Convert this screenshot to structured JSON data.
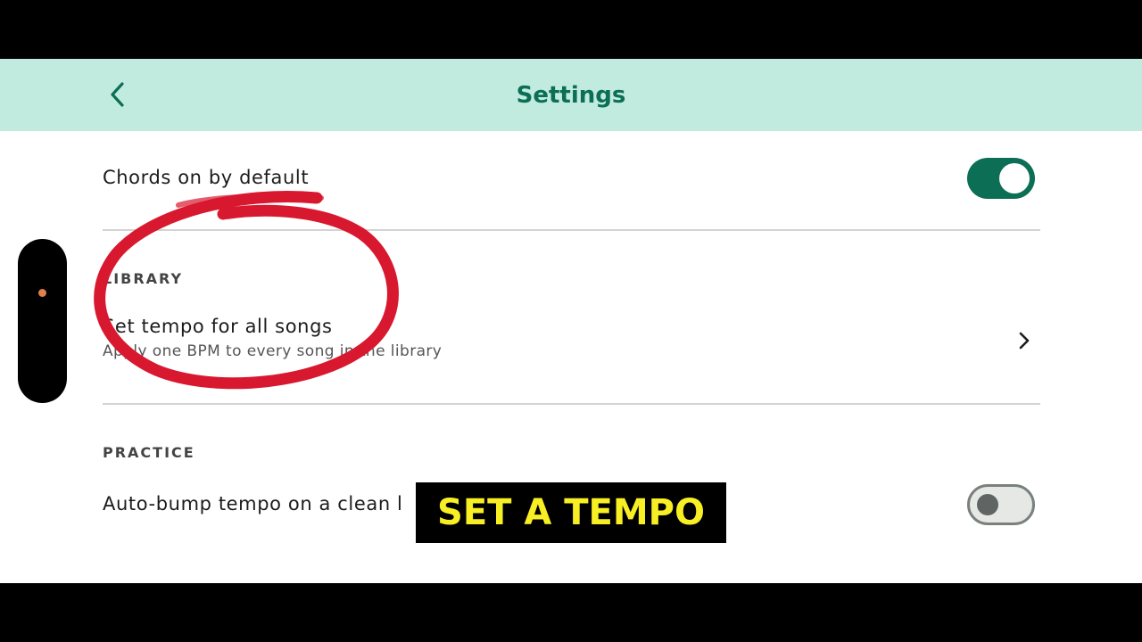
{
  "header": {
    "title": "Settings",
    "back_icon": "chevron-left-icon"
  },
  "settings": {
    "chords_default": {
      "label": "Chords on by default",
      "enabled": true
    },
    "library": {
      "section_label": "LIBRARY",
      "tempo_all": {
        "title": "Set tempo for all songs",
        "subtitle": "Apply one BPM to every song in the library",
        "icon": "chevron-right-icon"
      }
    },
    "practice": {
      "section_label": "PRACTICE",
      "auto_bump": {
        "label": "Auto-bump tempo on a clean l",
        "enabled": false
      }
    }
  },
  "overlay": {
    "caption": "SET A TEMPO",
    "annotation_color": "#d8182f",
    "caption_color": "#f7ef24"
  },
  "colors": {
    "app_bar": "#c2ebe0",
    "accent": "#0c6e55"
  }
}
